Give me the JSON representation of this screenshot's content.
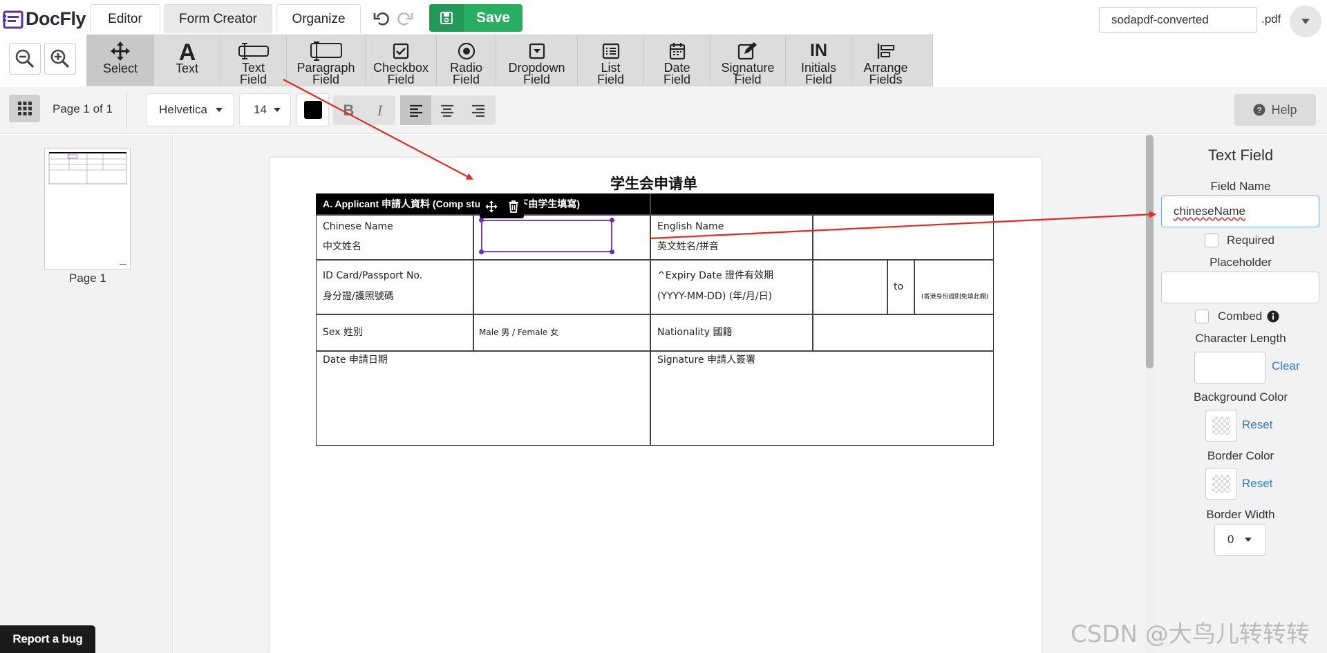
{
  "brand": {
    "name": "DocFly"
  },
  "tabs": [
    {
      "label": "Editor"
    },
    {
      "label": "Form Creator"
    },
    {
      "label": "Organize"
    }
  ],
  "save": {
    "label": "Save"
  },
  "file": {
    "name": "sodapdf-converted",
    "extension": ".pdf"
  },
  "tools": [
    {
      "label": "Select",
      "icon": "move-icon"
    },
    {
      "label": "Text",
      "icon": "text-a-icon"
    },
    {
      "label": "Text\nField",
      "icon": "text-field-icon"
    },
    {
      "label": "Paragraph\nField",
      "icon": "paragraph-field-icon"
    },
    {
      "label": "Checkbox\nField",
      "icon": "checkbox-icon"
    },
    {
      "label": "Radio\nField",
      "icon": "radio-icon"
    },
    {
      "label": "Dropdown\nField",
      "icon": "dropdown-icon"
    },
    {
      "label": "List\nField",
      "icon": "list-icon"
    },
    {
      "label": "Date\nField",
      "icon": "calendar-icon"
    },
    {
      "label": "Signature\nField",
      "icon": "signature-icon"
    },
    {
      "label": "Initials\nField",
      "icon": "initials-icon",
      "glyph": "IN"
    },
    {
      "label": "Arrange\nFields",
      "icon": "arrange-icon"
    }
  ],
  "format": {
    "page_label": "Page 1 of 1",
    "font": "Helvetica",
    "size": "14",
    "color": "#000000",
    "bold": "B",
    "italic": "I"
  },
  "help": {
    "label": "Help"
  },
  "thumbnail": {
    "label": "Page 1"
  },
  "report_bug": {
    "label": "Report a bug"
  },
  "document": {
    "title": "学生会申请单",
    "section_header": "A.    Applicant 申請人資料  (Comp     students 以下由学生填寫)",
    "cells": {
      "chinese_name_en": "Chinese Name",
      "chinese_name_zh": "中文姓名",
      "english_name_en": "English Name",
      "english_name_zh": "英文姓名/拼音",
      "id_en": "ID Card/Passport No.",
      "id_zh": "身分證/護照號碼",
      "expiry_en": "^Expiry Date  證件有效期",
      "expiry_fmt": "(YYYY-MM-DD) (年/月/日)",
      "to": "to",
      "permanent": "(香港身份證則免填此欄)",
      "sex": "Sex 姓別",
      "sex_options": "Male 男 / Female 女",
      "nationality": "Nationality 國籍",
      "date": "Date 申請日期",
      "signature": "Signature 申請人簽署"
    }
  },
  "properties": {
    "title": "Text Field",
    "field_name_label": "Field Name",
    "field_name_value": "chineseName",
    "required_label": "Required",
    "placeholder_label": "Placeholder",
    "placeholder_value": "",
    "combed_label": "Combed",
    "char_length_label": "Character Length",
    "char_length_value": "",
    "clear_label": "Clear",
    "bg_color_label": "Background Color",
    "border_color_label": "Border Color",
    "reset_label": "Reset",
    "border_width_label": "Border Width",
    "border_width_value": "0"
  },
  "watermark": "CSDN @大鸟儿转转转",
  "colors": {
    "accent_green": "#27ae60",
    "selection": "#7b3fd0",
    "annotation_arrow": "#e8281e"
  }
}
